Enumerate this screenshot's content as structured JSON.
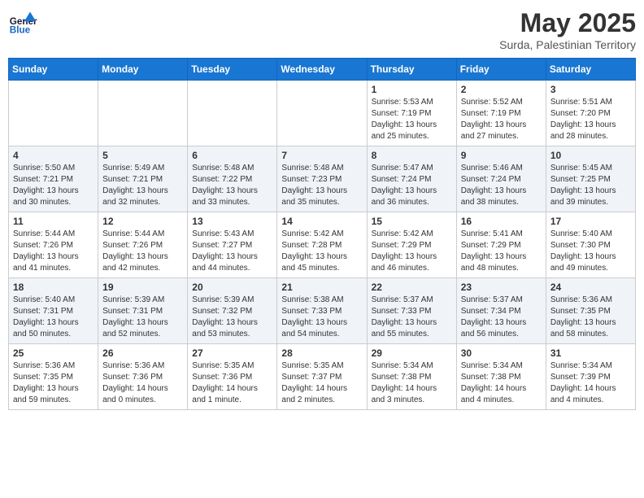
{
  "logo": {
    "line1": "General",
    "line2": "Blue"
  },
  "title": "May 2025",
  "location": "Surda, Palestinian Territory",
  "days_of_week": [
    "Sunday",
    "Monday",
    "Tuesday",
    "Wednesday",
    "Thursday",
    "Friday",
    "Saturday"
  ],
  "weeks": [
    [
      {
        "day": "",
        "info": ""
      },
      {
        "day": "",
        "info": ""
      },
      {
        "day": "",
        "info": ""
      },
      {
        "day": "",
        "info": ""
      },
      {
        "day": "1",
        "sunrise": "5:53 AM",
        "sunset": "7:19 PM",
        "daylight": "13 hours and 25 minutes."
      },
      {
        "day": "2",
        "sunrise": "5:52 AM",
        "sunset": "7:19 PM",
        "daylight": "13 hours and 27 minutes."
      },
      {
        "day": "3",
        "sunrise": "5:51 AM",
        "sunset": "7:20 PM",
        "daylight": "13 hours and 28 minutes."
      }
    ],
    [
      {
        "day": "4",
        "sunrise": "5:50 AM",
        "sunset": "7:21 PM",
        "daylight": "13 hours and 30 minutes."
      },
      {
        "day": "5",
        "sunrise": "5:49 AM",
        "sunset": "7:21 PM",
        "daylight": "13 hours and 32 minutes."
      },
      {
        "day": "6",
        "sunrise": "5:48 AM",
        "sunset": "7:22 PM",
        "daylight": "13 hours and 33 minutes."
      },
      {
        "day": "7",
        "sunrise": "5:48 AM",
        "sunset": "7:23 PM",
        "daylight": "13 hours and 35 minutes."
      },
      {
        "day": "8",
        "sunrise": "5:47 AM",
        "sunset": "7:24 PM",
        "daylight": "13 hours and 36 minutes."
      },
      {
        "day": "9",
        "sunrise": "5:46 AM",
        "sunset": "7:24 PM",
        "daylight": "13 hours and 38 minutes."
      },
      {
        "day": "10",
        "sunrise": "5:45 AM",
        "sunset": "7:25 PM",
        "daylight": "13 hours and 39 minutes."
      }
    ],
    [
      {
        "day": "11",
        "sunrise": "5:44 AM",
        "sunset": "7:26 PM",
        "daylight": "13 hours and 41 minutes."
      },
      {
        "day": "12",
        "sunrise": "5:44 AM",
        "sunset": "7:26 PM",
        "daylight": "13 hours and 42 minutes."
      },
      {
        "day": "13",
        "sunrise": "5:43 AM",
        "sunset": "7:27 PM",
        "daylight": "13 hours and 44 minutes."
      },
      {
        "day": "14",
        "sunrise": "5:42 AM",
        "sunset": "7:28 PM",
        "daylight": "13 hours and 45 minutes."
      },
      {
        "day": "15",
        "sunrise": "5:42 AM",
        "sunset": "7:29 PM",
        "daylight": "13 hours and 46 minutes."
      },
      {
        "day": "16",
        "sunrise": "5:41 AM",
        "sunset": "7:29 PM",
        "daylight": "13 hours and 48 minutes."
      },
      {
        "day": "17",
        "sunrise": "5:40 AM",
        "sunset": "7:30 PM",
        "daylight": "13 hours and 49 minutes."
      }
    ],
    [
      {
        "day": "18",
        "sunrise": "5:40 AM",
        "sunset": "7:31 PM",
        "daylight": "13 hours and 50 minutes."
      },
      {
        "day": "19",
        "sunrise": "5:39 AM",
        "sunset": "7:31 PM",
        "daylight": "13 hours and 52 minutes."
      },
      {
        "day": "20",
        "sunrise": "5:39 AM",
        "sunset": "7:32 PM",
        "daylight": "13 hours and 53 minutes."
      },
      {
        "day": "21",
        "sunrise": "5:38 AM",
        "sunset": "7:33 PM",
        "daylight": "13 hours and 54 minutes."
      },
      {
        "day": "22",
        "sunrise": "5:37 AM",
        "sunset": "7:33 PM",
        "daylight": "13 hours and 55 minutes."
      },
      {
        "day": "23",
        "sunrise": "5:37 AM",
        "sunset": "7:34 PM",
        "daylight": "13 hours and 56 minutes."
      },
      {
        "day": "24",
        "sunrise": "5:36 AM",
        "sunset": "7:35 PM",
        "daylight": "13 hours and 58 minutes."
      }
    ],
    [
      {
        "day": "25",
        "sunrise": "5:36 AM",
        "sunset": "7:35 PM",
        "daylight": "13 hours and 59 minutes."
      },
      {
        "day": "26",
        "sunrise": "5:36 AM",
        "sunset": "7:36 PM",
        "daylight": "14 hours and 0 minutes."
      },
      {
        "day": "27",
        "sunrise": "5:35 AM",
        "sunset": "7:36 PM",
        "daylight": "14 hours and 1 minute."
      },
      {
        "day": "28",
        "sunrise": "5:35 AM",
        "sunset": "7:37 PM",
        "daylight": "14 hours and 2 minutes."
      },
      {
        "day": "29",
        "sunrise": "5:34 AM",
        "sunset": "7:38 PM",
        "daylight": "14 hours and 3 minutes."
      },
      {
        "day": "30",
        "sunrise": "5:34 AM",
        "sunset": "7:38 PM",
        "daylight": "14 hours and 4 minutes."
      },
      {
        "day": "31",
        "sunrise": "5:34 AM",
        "sunset": "7:39 PM",
        "daylight": "14 hours and 4 minutes."
      }
    ]
  ]
}
